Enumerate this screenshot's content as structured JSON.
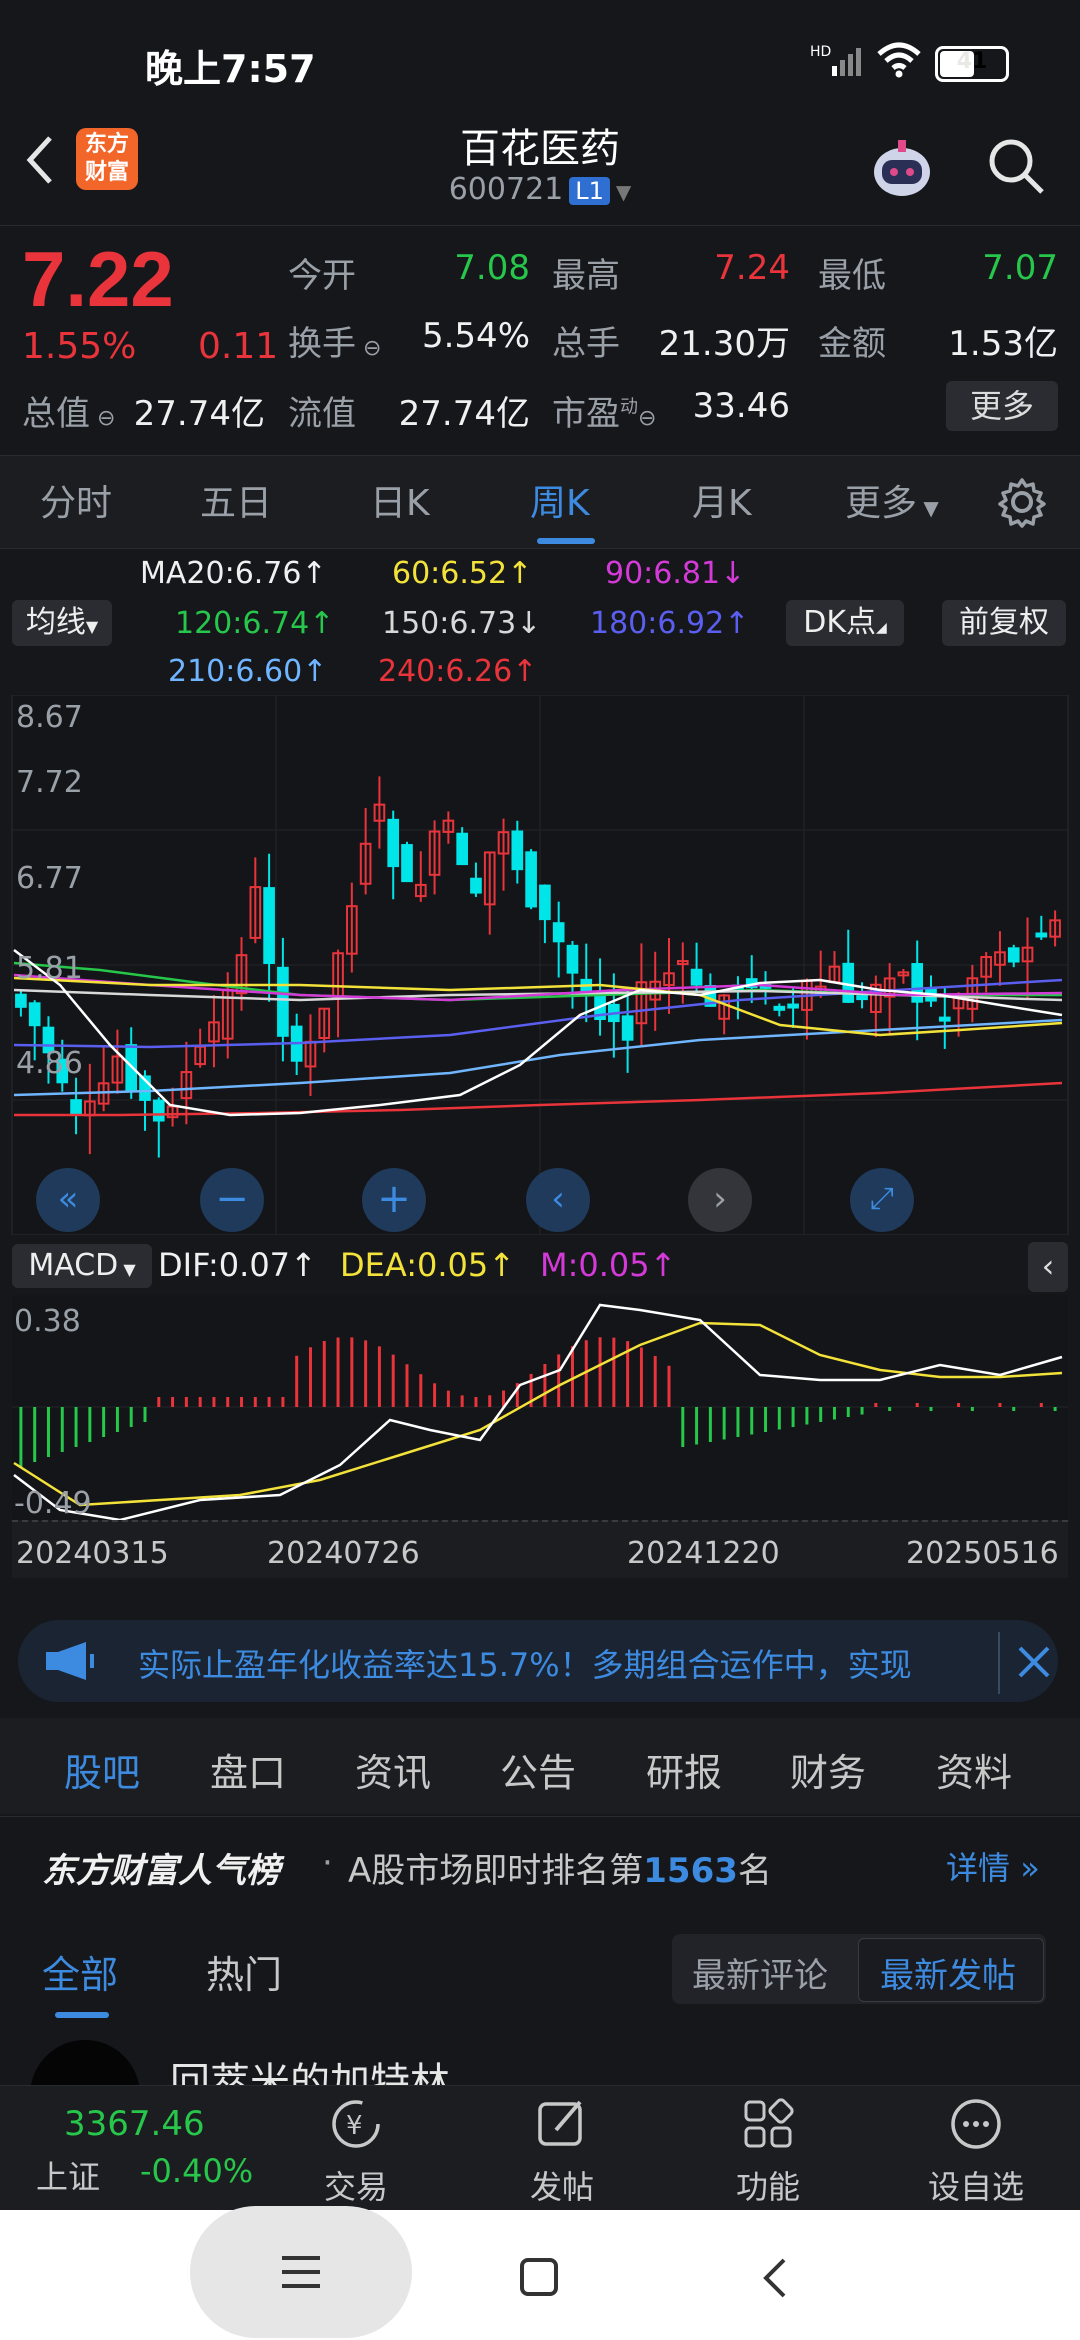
{
  "status_bar": {
    "time": "晚上7:57",
    "battery": "41"
  },
  "header": {
    "name": "百花医药",
    "code": "600721",
    "level": "L1",
    "brand": "东方财富"
  },
  "quote": {
    "price": "7.22",
    "change_pct": "1.55%",
    "change": "0.11",
    "labels": {
      "open": "今开",
      "high": "最高",
      "low": "最低",
      "turnover": "换手",
      "volume": "总手",
      "amount": "金额",
      "mktcap": "总值",
      "float_cap": "流值",
      "pe": "市盈"
    },
    "values": {
      "open": "7.08",
      "high": "7.24",
      "low": "7.07",
      "turnover": "5.54%",
      "volume": "21.30万",
      "amount": "1.53亿",
      "mktcap": "27.74亿",
      "float_cap": "27.74亿",
      "pe": "33.46"
    },
    "pe_sup": "动",
    "more": "更多"
  },
  "period_tabs": [
    "分时",
    "五日",
    "日K",
    "周K",
    "月K",
    "更多"
  ],
  "active_period": "周K",
  "ma": {
    "toggle": "均线",
    "items": [
      {
        "text": "MA20:6.76↑",
        "color": "#f0f0f0"
      },
      {
        "text": "60:6.52↑",
        "color": "#f2e23a"
      },
      {
        "text": "90:6.81↓",
        "color": "#d43ad8"
      },
      {
        "text": "120:6.74↑",
        "color": "#26c74a"
      },
      {
        "text": "150:6.73↓",
        "color": "#d8d8d8"
      },
      {
        "text": "180:6.92↑",
        "color": "#5a5ff0"
      },
      {
        "text": "210:6.60↑",
        "color": "#6fb5ff"
      },
      {
        "text": "240:6.26↑",
        "color": "#e8343a"
      }
    ],
    "dk": "DK点",
    "adjust": "前复权"
  },
  "price_axis": [
    "8.67",
    "7.72",
    "6.77",
    "5.81",
    "4.86"
  ],
  "macd": {
    "toggle": "MACD",
    "dif": "DIF:0.07↑",
    "dea": "DEA:0.05↑",
    "m": "M:0.05↑",
    "axis_top": "0.38",
    "axis_bottom": "-0.49"
  },
  "dates": [
    "20240315",
    "20240726",
    "20241220",
    "20250516"
  ],
  "notice": "实际止盈年化收益率达15.7%！多期组合运作中，实现",
  "bottom_tabs": [
    "股吧",
    "盘口",
    "资讯",
    "公告",
    "研报",
    "财务",
    "资料"
  ],
  "rank": {
    "title": "东方财富人气榜",
    "dot": "·",
    "prefix": "A股市场即时排名第",
    "num": "1563",
    "suffix": "名",
    "detail": "详情"
  },
  "filter": {
    "tabs": [
      "全部",
      "热门"
    ],
    "sort": [
      "最新评论",
      "最新发帖"
    ]
  },
  "post_preview": "回萃米的加特林",
  "bottom_bar": {
    "index_value": "3367.46",
    "index_name": "上证",
    "index_change": "-0.40%",
    "items": [
      "交易",
      "发帖",
      "功能",
      "设自选"
    ]
  },
  "colors": {
    "up": "#e8343a",
    "down": "#00e5e8",
    "accent": "#3d8be0"
  }
}
